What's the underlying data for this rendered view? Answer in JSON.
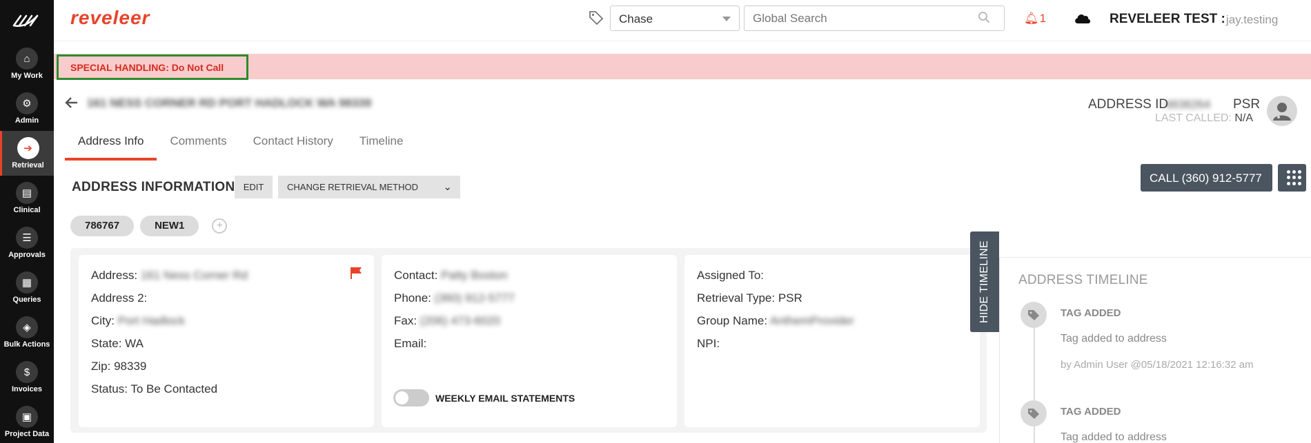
{
  "brand": "reveleer",
  "nav": [
    {
      "label": "My Work",
      "icon": "home-icon",
      "glyph": "⌂"
    },
    {
      "label": "Admin",
      "icon": "gear-icon",
      "glyph": "⚙"
    },
    {
      "label": "Retrieval",
      "icon": "retrieval-icon",
      "glyph": "➔",
      "active": true
    },
    {
      "label": "Clinical",
      "icon": "clinical-icon",
      "glyph": "▤"
    },
    {
      "label": "Approvals",
      "icon": "checklist-icon",
      "glyph": "☰"
    },
    {
      "label": "Queries",
      "icon": "queries-icon",
      "glyph": "▦"
    },
    {
      "label": "Bulk Actions",
      "icon": "layers-icon",
      "glyph": "◈"
    },
    {
      "label": "Invoices",
      "icon": "dollar-icon",
      "glyph": "$"
    },
    {
      "label": "Project Data",
      "icon": "project-data-icon",
      "glyph": "▣"
    }
  ],
  "header": {
    "project_select": "Chase",
    "search_placeholder": "Global Search",
    "notification_count": "1",
    "user_title": "REVELEER TEST :",
    "user_name": "jay.testing"
  },
  "special_handling": "SPECIAL HANDLING: Do Not Call",
  "address_header": {
    "address_line": "161 NESS CORNER RD PORT HADLOCK WA 98339",
    "address_id_label": "ADDRESS ID",
    "address_id_value": "4838264",
    "psr": "PSR",
    "last_called_label": "LAST CALLED:",
    "last_called_value": "N/A"
  },
  "tabs": [
    "Address Info",
    "Comments",
    "Contact History",
    "Timeline"
  ],
  "address_info": {
    "title": "ADDRESS INFORMATION",
    "edit": "EDIT",
    "change_method": "CHANGE RETRIEVAL METHOD",
    "call_button": "CALL (360) 912-5777"
  },
  "chips": [
    "786767",
    "NEW1"
  ],
  "card_address": {
    "address_label": "Address:",
    "address_value": "161 Ness Corner Rd",
    "address2_label": "Address 2:",
    "city_label": "City:",
    "city_value": "Port Hadlock",
    "state_label": "State:",
    "state_value": "WA",
    "zip_label": "Zip:",
    "zip_value": "98339",
    "status_label": "Status:",
    "status_value": "To Be Contacted"
  },
  "card_contact": {
    "contact_label": "Contact:",
    "contact_value": "Patty Boston",
    "phone_label": "Phone:",
    "phone_value": "(360) 912-5777",
    "fax_label": "Fax:",
    "fax_value": "(206) 473-6020",
    "email_label": "Email:",
    "toggle_label": "WEEKLY EMAIL STATEMENTS"
  },
  "card_assign": {
    "assigned_label": "Assigned To:",
    "retrieval_label": "Retrieval Type:",
    "retrieval_value": "PSR",
    "group_label": "Group Name:",
    "group_value": "AnthemProvider",
    "npi_label": "NPI:"
  },
  "hide_timeline": "HIDE TIMELINE",
  "timeline": {
    "title": "ADDRESS TIMELINE",
    "entries": [
      {
        "heading": "TAG ADDED",
        "desc": "Tag added to address",
        "by": "by Admin User @05/18/2021 12:16:32 am"
      },
      {
        "heading": "TAG ADDED",
        "desc": "Tag added to address",
        "by": ""
      }
    ]
  },
  "colors": {
    "accent": "#e8432a",
    "sidebar": "#111111",
    "button_dark": "#4a5560",
    "banner": "#f8cccc",
    "highlight_border": "#2e8b2e"
  }
}
